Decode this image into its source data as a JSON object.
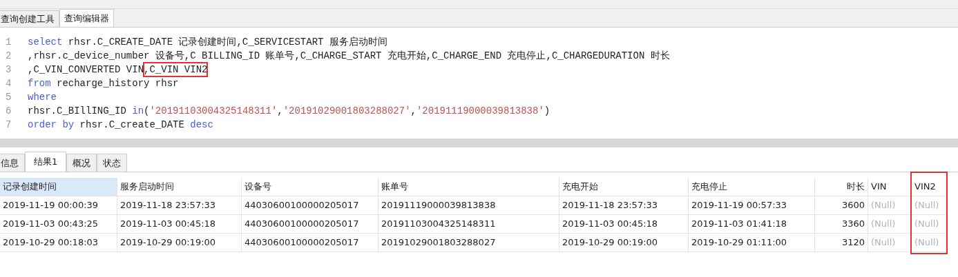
{
  "editor_tabs": [
    {
      "label": "查询创建工具",
      "selected": false
    },
    {
      "label": "查询编辑器",
      "selected": true
    }
  ],
  "code_lines": [
    {
      "number": "1",
      "segments": [
        {
          "kind": "keyword",
          "text": "select",
          "highlighted": false
        },
        {
          "kind": "plain",
          "text": " rhsr.C_CREATE_DATE 记录创建时间,C_SERVICESTART 服务启动时间",
          "highlighted": false
        }
      ]
    },
    {
      "number": "2",
      "segments": [
        {
          "kind": "plain",
          "text": ",rhsr.c_device_number 设备号,C BILLING_ID 账单号,C_CHARGE_START 充电开始,C_CHARGE_END 充电停止,C_CHARGEDURATION 时长",
          "highlighted": false
        }
      ]
    },
    {
      "number": "3",
      "segments": [
        {
          "kind": "plain",
          "text": ",C_VIN_CONVERTED VIN",
          "highlighted": false
        },
        {
          "kind": "plain",
          "text": ",C_VIN VIN2",
          "highlighted": true
        }
      ]
    },
    {
      "number": "4",
      "segments": [
        {
          "kind": "keyword",
          "text": "from",
          "highlighted": false
        },
        {
          "kind": "plain",
          "text": " recharge_history rhsr",
          "highlighted": false
        }
      ]
    },
    {
      "number": "5",
      "segments": [
        {
          "kind": "keyword",
          "text": "where",
          "highlighted": false
        }
      ]
    },
    {
      "number": "6",
      "segments": [
        {
          "kind": "plain",
          "text": "rhsr.C_BIllING_ID ",
          "highlighted": false
        },
        {
          "kind": "keyword",
          "text": "in",
          "highlighted": false
        },
        {
          "kind": "plain",
          "text": "(",
          "highlighted": false
        },
        {
          "kind": "string",
          "text": "'20191103004325148311'",
          "highlighted": false
        },
        {
          "kind": "plain",
          "text": ",",
          "highlighted": false
        },
        {
          "kind": "string",
          "text": "'20191029001803288027'",
          "highlighted": false
        },
        {
          "kind": "plain",
          "text": ",",
          "highlighted": false
        },
        {
          "kind": "string",
          "text": "'20191119000039813838'",
          "highlighted": false
        },
        {
          "kind": "plain",
          "text": ")",
          "highlighted": false
        }
      ]
    },
    {
      "number": "7",
      "segments": [
        {
          "kind": "keyword",
          "text": "order by",
          "highlighted": false
        },
        {
          "kind": "plain",
          "text": " rhsr.C_create_DATE ",
          "highlighted": false
        },
        {
          "kind": "keyword",
          "text": "desc",
          "highlighted": false
        }
      ]
    }
  ],
  "result_tabs": [
    {
      "label": "信息",
      "selected": false
    },
    {
      "label": "结果1",
      "selected": true
    },
    {
      "label": "概况",
      "selected": false
    },
    {
      "label": "状态",
      "selected": false
    }
  ],
  "table": {
    "columns": [
      {
        "label": "记录创建时间",
        "selected": true,
        "right_aligned": false,
        "highlighted": false
      },
      {
        "label": "服务启动时间",
        "selected": false,
        "right_aligned": false,
        "highlighted": false
      },
      {
        "label": "设备号",
        "selected": false,
        "right_aligned": false,
        "highlighted": false
      },
      {
        "label": "账单号",
        "selected": false,
        "right_aligned": false,
        "highlighted": false
      },
      {
        "label": "充电开始",
        "selected": false,
        "right_aligned": false,
        "highlighted": false
      },
      {
        "label": "充电停止",
        "selected": false,
        "right_aligned": false,
        "highlighted": false
      },
      {
        "label": "时长",
        "selected": false,
        "right_aligned": true,
        "highlighted": false
      },
      {
        "label": "VIN",
        "selected": false,
        "right_aligned": false,
        "highlighted": false
      },
      {
        "label": "VIN2",
        "selected": false,
        "right_aligned": false,
        "highlighted": true
      }
    ],
    "rows": [
      {
        "cells": [
          {
            "text": "2019-11-19 00:00:39",
            "null": false
          },
          {
            "text": "2019-11-18 23:57:33",
            "null": false
          },
          {
            "text": "44030600100000205017",
            "null": false
          },
          {
            "text": "20191119000039813838",
            "null": false
          },
          {
            "text": "2019-11-18 23:57:33",
            "null": false
          },
          {
            "text": "2019-11-19 00:57:33",
            "null": false
          },
          {
            "text": "3600",
            "null": false
          },
          {
            "text": "(Null)",
            "null": true
          },
          {
            "text": "(Null)",
            "null": true
          }
        ]
      },
      {
        "cells": [
          {
            "text": "2019-11-03 00:43:25",
            "null": false
          },
          {
            "text": "2019-11-03 00:45:18",
            "null": false
          },
          {
            "text": "44030600100000205017",
            "null": false
          },
          {
            "text": "20191103004325148311",
            "null": false
          },
          {
            "text": "2019-11-03 00:45:18",
            "null": false
          },
          {
            "text": "2019-11-03 01:41:18",
            "null": false
          },
          {
            "text": "3360",
            "null": false
          },
          {
            "text": "(Null)",
            "null": true
          },
          {
            "text": "(Null)",
            "null": true
          }
        ]
      },
      {
        "cells": [
          {
            "text": "2019-10-29 00:18:03",
            "null": false
          },
          {
            "text": "2019-10-29 00:19:00",
            "null": false
          },
          {
            "text": "44030600100000205017",
            "null": false
          },
          {
            "text": "20191029001803288027",
            "null": false
          },
          {
            "text": "2019-10-29 00:19:00",
            "null": false
          },
          {
            "text": "2019-10-29 01:11:00",
            "null": false
          },
          {
            "text": "3120",
            "null": false
          },
          {
            "text": "(Null)",
            "null": true
          },
          {
            "text": "(Null)",
            "null": true
          }
        ]
      }
    ]
  }
}
